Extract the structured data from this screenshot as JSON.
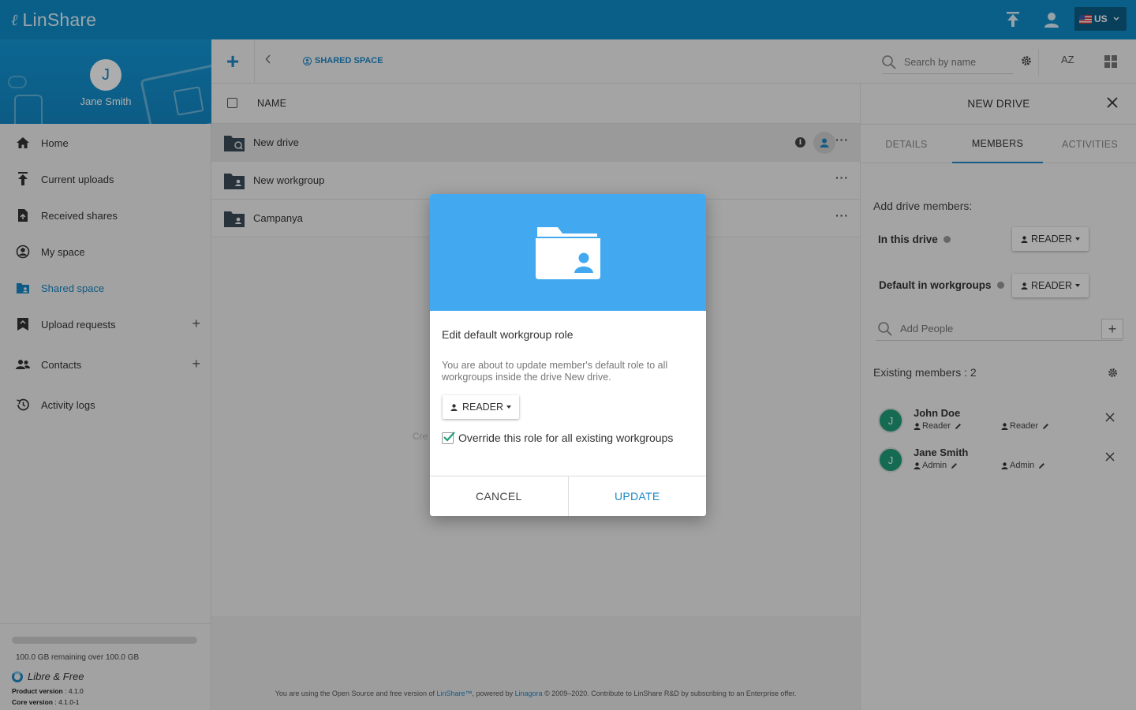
{
  "app": {
    "name": "LinShare"
  },
  "topbar": {
    "language": "US"
  },
  "user": {
    "initial": "J",
    "name": "Jane Smith"
  },
  "nav": {
    "items": [
      {
        "label": "Home",
        "icon": "home-icon"
      },
      {
        "label": "Current uploads",
        "icon": "upload-icon"
      },
      {
        "label": "Received shares",
        "icon": "received-shares-icon"
      },
      {
        "label": "My space",
        "icon": "my-space-icon"
      },
      {
        "label": "Shared space",
        "icon": "shared-space-icon",
        "active": true
      },
      {
        "label": "Upload requests",
        "icon": "upload-requests-icon"
      },
      {
        "label": "Contacts",
        "icon": "contacts-icon"
      },
      {
        "label": "Activity logs",
        "icon": "history-icon"
      }
    ],
    "plus": "+"
  },
  "storage": {
    "text": "100.0 GB remaining over 100.0 GB",
    "used_fraction": 0.0,
    "edition": "Libre & Free",
    "product_label": "Product version",
    "product_version": ": 4.1.0",
    "core_label": "Core version",
    "core_version": ": 4.1.0-1"
  },
  "toolbar": {
    "breadcrumb": "SHARED SPACE",
    "search_placeholder": "Search by name",
    "sort_label": "AZ"
  },
  "list": {
    "header": "NAME",
    "rows": [
      {
        "name": "New drive",
        "selected": true
      },
      {
        "name": "New workgroup"
      },
      {
        "name": "Campanya"
      }
    ],
    "more": "···",
    "empty_partial": "Cre"
  },
  "footer": {
    "prefix": "You are using the Open Source and free version of ",
    "linshare": "LinShare™",
    "middle": ", powered by ",
    "linagora": "Linagora",
    "suffix": " © 2009–2020. Contribute to LinShare R&D by subscribing to an Enterprise offer."
  },
  "panel": {
    "title": "NEW DRIVE",
    "tabs": [
      "DETAILS",
      "MEMBERS",
      "ACTIVITIES"
    ],
    "add_members_label": "Add drive members:",
    "in_drive_label": "In this drive",
    "in_drive_role": "READER",
    "default_label": "Default in workgroups",
    "default_role": "READER",
    "add_people_placeholder": "Add People",
    "existing_label": "Existing members : 2",
    "members": [
      {
        "initial": "J",
        "name": "John Doe",
        "drive_role": "Reader",
        "wg_role": "Reader"
      },
      {
        "initial": "J",
        "name": "Jane Smith",
        "drive_role": "Admin",
        "wg_role": "Admin"
      }
    ]
  },
  "modal": {
    "title": "Edit default workgroup role",
    "description": "You are about to update member's default role to all workgroups inside the drive New drive.",
    "role": "READER",
    "override_label": "Override this role for all existing workgroups",
    "override_checked": true,
    "cancel": "CANCEL",
    "update": "UPDATE"
  },
  "colors": {
    "brand": "#0f8cc9",
    "accent": "#1e88c7",
    "modal_hero": "#42a9f0",
    "member_avatar": "#1f9d7a"
  }
}
